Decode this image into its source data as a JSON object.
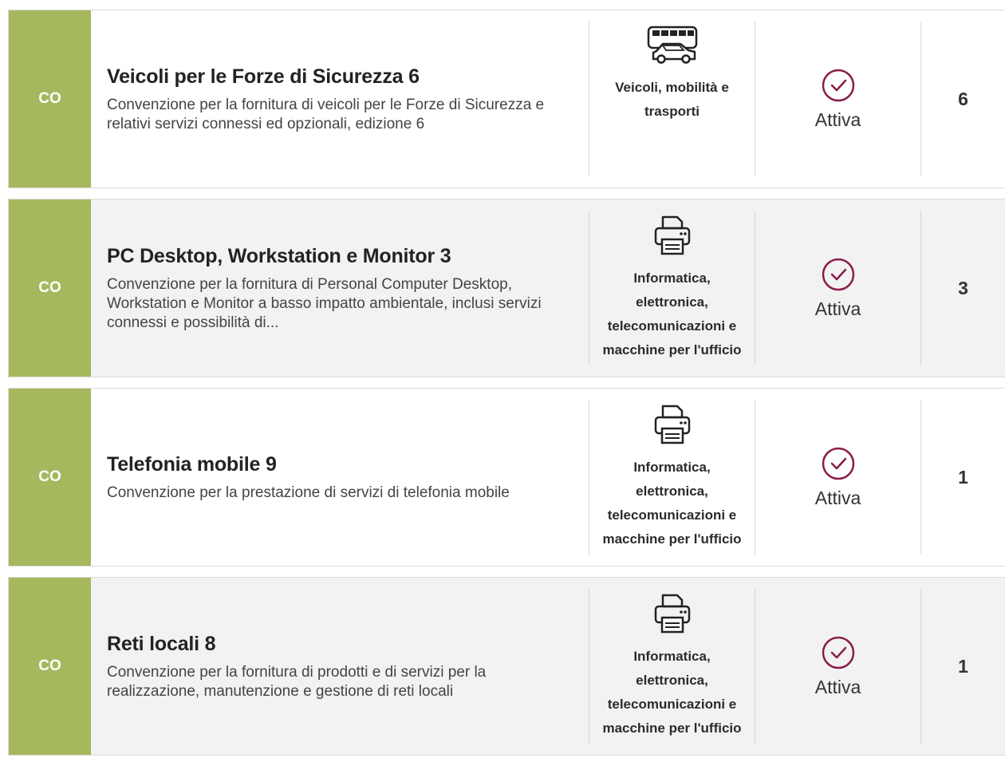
{
  "items": [
    {
      "tag": "CO",
      "title": "Veicoli per le Forze di Sicurezza 6",
      "description": "Convenzione per la fornitura di veicoli per le Forze di Sicurezza e relativi servizi connessi ed opzionali, edizione 6",
      "category_icon": "bus-car-icon",
      "category": "Veicoli, mobilità e trasporti",
      "status_icon": "check-circle-icon",
      "status": "Attiva",
      "count": "6"
    },
    {
      "tag": "CO",
      "title": "PC Desktop, Workstation e Monitor 3",
      "description": "Convenzione per la fornitura di Personal Computer Desktop, Workstation e Monitor a basso impatto ambientale, inclusi servizi connessi e possibilità di...",
      "category_icon": "printer-icon",
      "category": "Informatica, elettronica, telecomunicazioni e macchine per l'ufficio",
      "status_icon": "check-circle-icon",
      "status": "Attiva",
      "count": "3"
    },
    {
      "tag": "CO",
      "title": "Telefonia mobile 9",
      "description": "Convenzione per la prestazione di servizi di telefonia mobile",
      "category_icon": "printer-icon",
      "category": "Informatica, elettronica, telecomunicazioni e macchine per l'ufficio",
      "status_icon": "check-circle-icon",
      "status": "Attiva",
      "count": "1"
    },
    {
      "tag": "CO",
      "title": "Reti locali 8",
      "description": "Convenzione per la fornitura di prodotti e di servizi per la realizzazione, manutenzione e gestione di reti locali",
      "category_icon": "printer-icon",
      "category": "Informatica, elettronica, telecomunicazioni e macchine per l'ufficio",
      "status_icon": "check-circle-icon",
      "status": "Attiva",
      "count": "1"
    }
  ],
  "colors": {
    "tag_bg": "#a5b85e",
    "status_icon": "#8a1c4a",
    "alt_row_bg": "#f2f2f2"
  }
}
